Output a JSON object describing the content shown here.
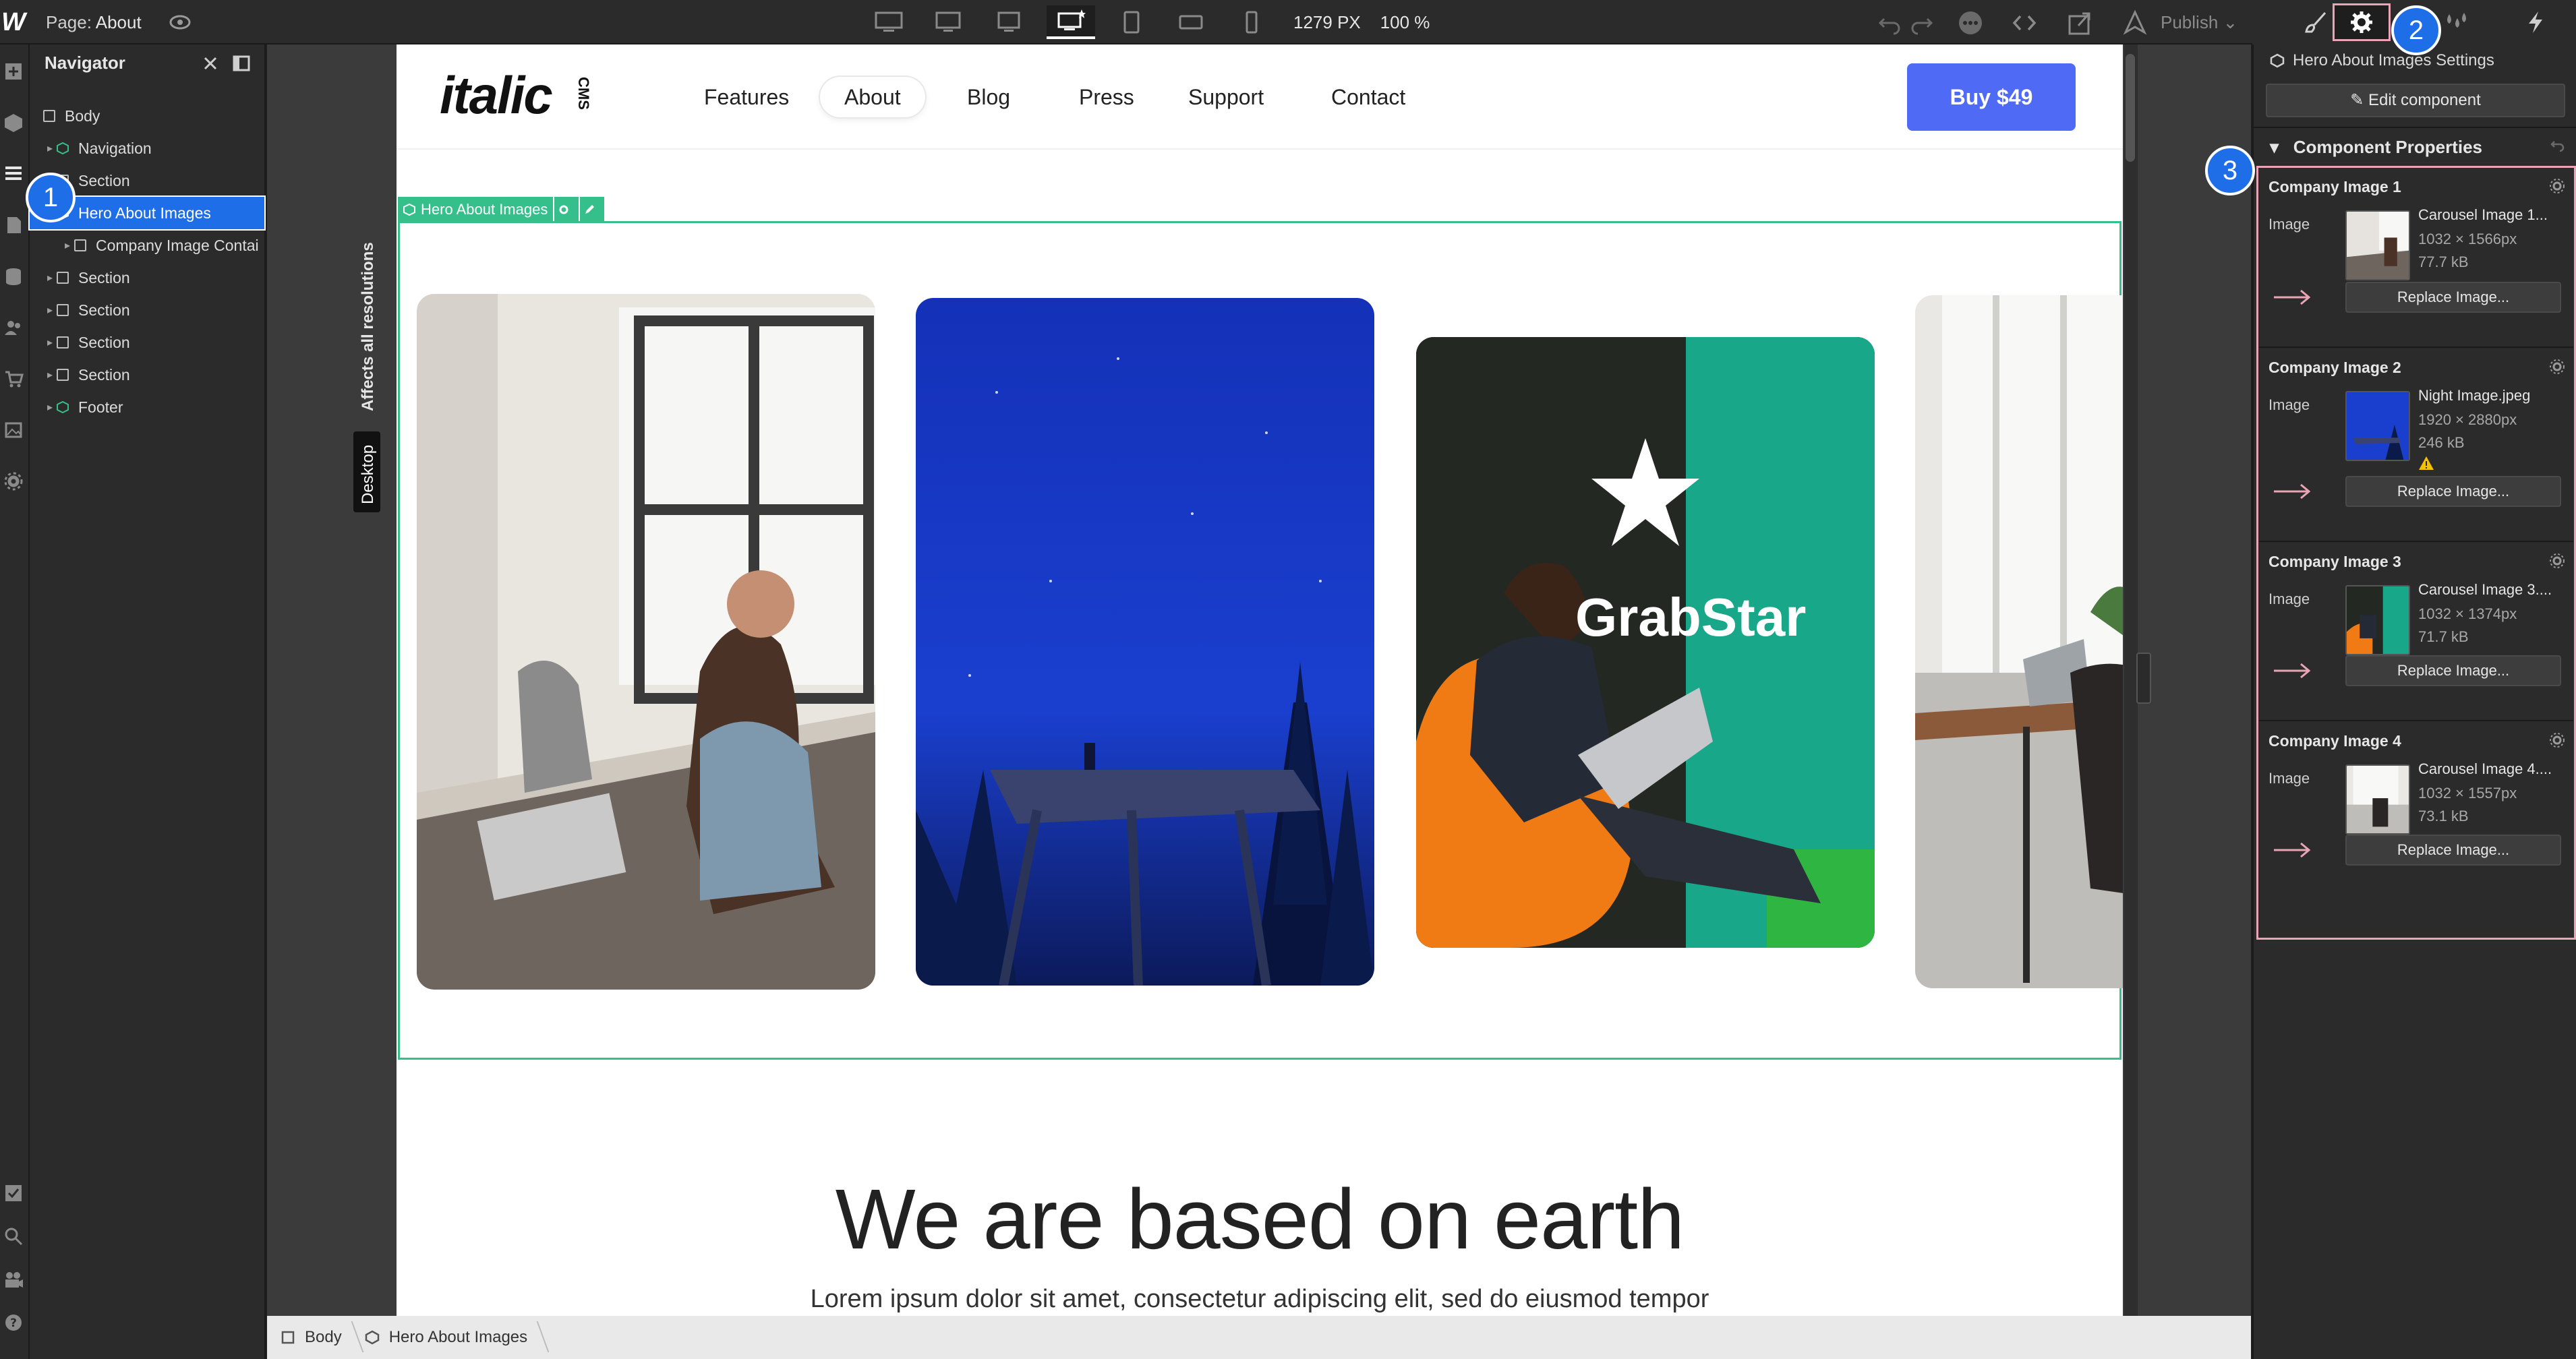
{
  "topbar": {
    "logo": "W",
    "page_prefix": "Page:",
    "page_name": "About",
    "width_px": "1279 PX",
    "zoom": "100 %",
    "publish_label": "Publish"
  },
  "navigator": {
    "title": "Navigator",
    "items": [
      {
        "label": "Body"
      },
      {
        "label": "Navigation"
      },
      {
        "label": "Section"
      },
      {
        "label": "Hero About Images"
      },
      {
        "label": "Company Image Contai"
      },
      {
        "label": "Section"
      },
      {
        "label": "Section"
      },
      {
        "label": "Section"
      },
      {
        "label": "Section"
      },
      {
        "label": "Footer"
      }
    ]
  },
  "badges": [
    "1",
    "2",
    "3"
  ],
  "canvas": {
    "affects_label": "Affects all resolutions",
    "desktop_label": "Desktop"
  },
  "site": {
    "logo": "italic",
    "logo_sub": "CMS",
    "nav": [
      "Features",
      "About",
      "Blog",
      "Press",
      "Support",
      "Contact"
    ],
    "buy_label": "Buy $49",
    "hero_tag": "Hero About Images",
    "headline": "We are based on earth",
    "lorem": "Lorem ipsum dolor sit amet, consectetur adipiscing elit, sed do eiusmod tempor",
    "card3_brand": "GrabStar"
  },
  "breadcrumbs": [
    "Body",
    "Hero About Images"
  ],
  "settings": {
    "title": "Hero About Images Settings",
    "edit_label": "Edit component",
    "section_title": "Component Properties",
    "image_label": "Image",
    "replace_label": "Replace Image...",
    "props": [
      {
        "title": "Company Image 1",
        "name": "Carousel Image 1...",
        "dim": "1032 × 1566px",
        "size": "77.7 kB"
      },
      {
        "title": "Company Image 2",
        "name": "Night Image.jpeg",
        "dim": "1920 × 2880px",
        "size": "246 kB"
      },
      {
        "title": "Company Image 3",
        "name": "Carousel Image 3....",
        "dim": "1032 × 1374px",
        "size": "71.7 kB"
      },
      {
        "title": "Company Image 4",
        "name": "Carousel Image 4....",
        "dim": "1032 × 1557px",
        "size": "73.1 kB"
      }
    ]
  },
  "colors": {
    "accent": "#1e6ee8",
    "component_green": "#35c08b",
    "highlight_pink": "#e9a5b6",
    "buy_button": "#4f6af5"
  }
}
